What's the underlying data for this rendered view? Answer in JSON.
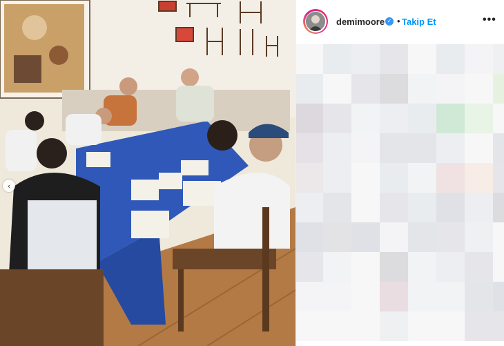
{
  "post": {
    "username": "demimoore",
    "separator": "•",
    "follow_label": "Takip Et",
    "more_icon": "more-options-icon",
    "verified_icon": "verified-badge-icon"
  },
  "photo": {
    "carousel_prev_glyph": "‹"
  }
}
